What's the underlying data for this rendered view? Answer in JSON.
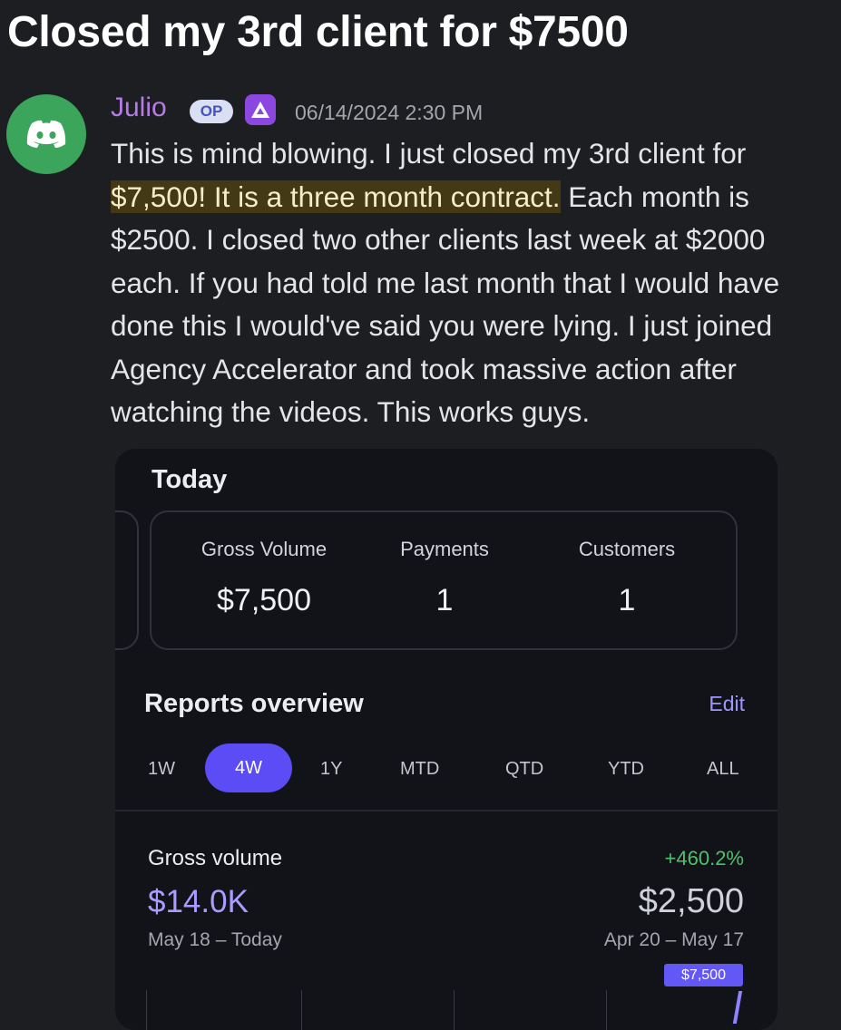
{
  "headline": "Closed my 3rd client for $7500",
  "post": {
    "username": "Julio",
    "badge": "OP",
    "timestamp": "06/14/2024 2:30 PM",
    "message": {
      "part1": "This is mind blowing. I just closed my 3rd client for ",
      "highlight": "$7,500! It is a three month contract.",
      "part2": " Each month is $2500. I closed two other clients last week at $2000 each. If you had told me last month that I would have done this I would've said you were lying. I just joined Agency Accelerator and took massive action after watching the videos. This works guys."
    },
    "avatar_icon": "discord-logo-icon",
    "role_icon": "triangle-role-icon",
    "colors": {
      "username": "#b67be6",
      "avatar": "#3ba55c",
      "highlight": "#433a15"
    }
  },
  "dashboard": {
    "today_title": "Today",
    "stats": [
      {
        "label": "Gross Volume",
        "value": "$7,500"
      },
      {
        "label": "Payments",
        "value": "1"
      },
      {
        "label": "Customers",
        "value": "1"
      }
    ],
    "reports_title": "Reports overview",
    "edit_label": "Edit",
    "tabs": [
      "1W",
      "4W",
      "1Y",
      "MTD",
      "QTD",
      "YTD",
      "ALL"
    ],
    "active_tab": "4W",
    "gross_volume": {
      "label": "Gross volume",
      "value": "$14.0K",
      "range": "May 18 – Today",
      "change": "+460.2%",
      "previous_value": "$2,500",
      "previous_range": "Apr 20 – May 17",
      "tooltip": "$7,500"
    },
    "colors": {
      "accent": "#5b4cf5",
      "positive": "#4cc26a",
      "link": "#a094ff"
    }
  }
}
